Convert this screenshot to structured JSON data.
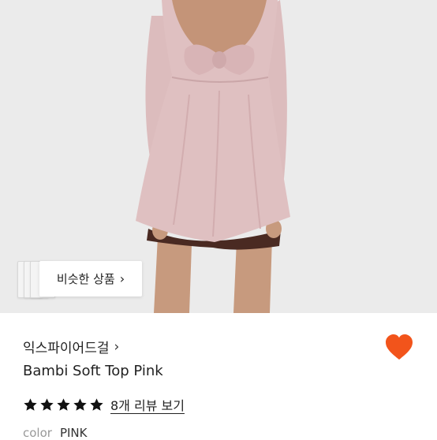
{
  "product_image": {
    "alt": "",
    "similar_button_label": "비슷한 상품",
    "similar_button_icon": "chevron-right-icon"
  },
  "product": {
    "brand": "익스파이어드걸",
    "brand_icon": "chevron-right-icon",
    "name": "Bambi Soft Top Pink",
    "rating": 5,
    "rating_max": 5,
    "review_link": "8개 리뷰 보기",
    "color_label": "color",
    "color_value": "PINK"
  },
  "colors": {
    "heart": "#f2541b",
    "star": "#111111"
  }
}
